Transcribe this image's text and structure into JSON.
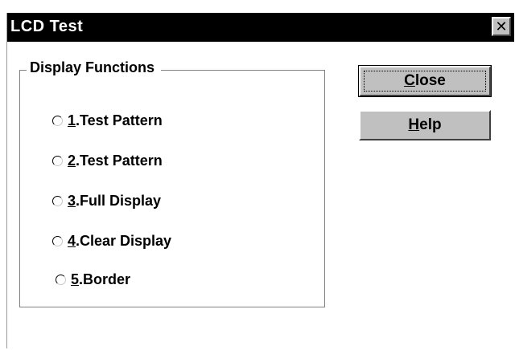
{
  "window": {
    "title": "LCD Test",
    "close_glyph": "✕"
  },
  "group": {
    "label": "Display Functions",
    "options": [
      {
        "mnemonic": "1",
        "text": ".Test Pattern",
        "checked": false
      },
      {
        "mnemonic": "2",
        "text": ".Test Pattern",
        "checked": false
      },
      {
        "mnemonic": "3",
        "text": ".Full Display",
        "checked": false
      },
      {
        "mnemonic": "4",
        "text": ".Clear Display",
        "checked": false
      },
      {
        "mnemonic": "5",
        "text": ".Border",
        "checked": false
      }
    ]
  },
  "buttons": {
    "close": {
      "mnemonic": "C",
      "rest": "lose"
    },
    "help": {
      "mnemonic": "H",
      "rest": "elp"
    }
  },
  "icons": {
    "window_close": "close-icon",
    "radio": "radio-button-unchecked-icon"
  },
  "colors": {
    "titlebar": "#000000",
    "button_face": "#c0c0c0",
    "background": "#ffffff"
  }
}
